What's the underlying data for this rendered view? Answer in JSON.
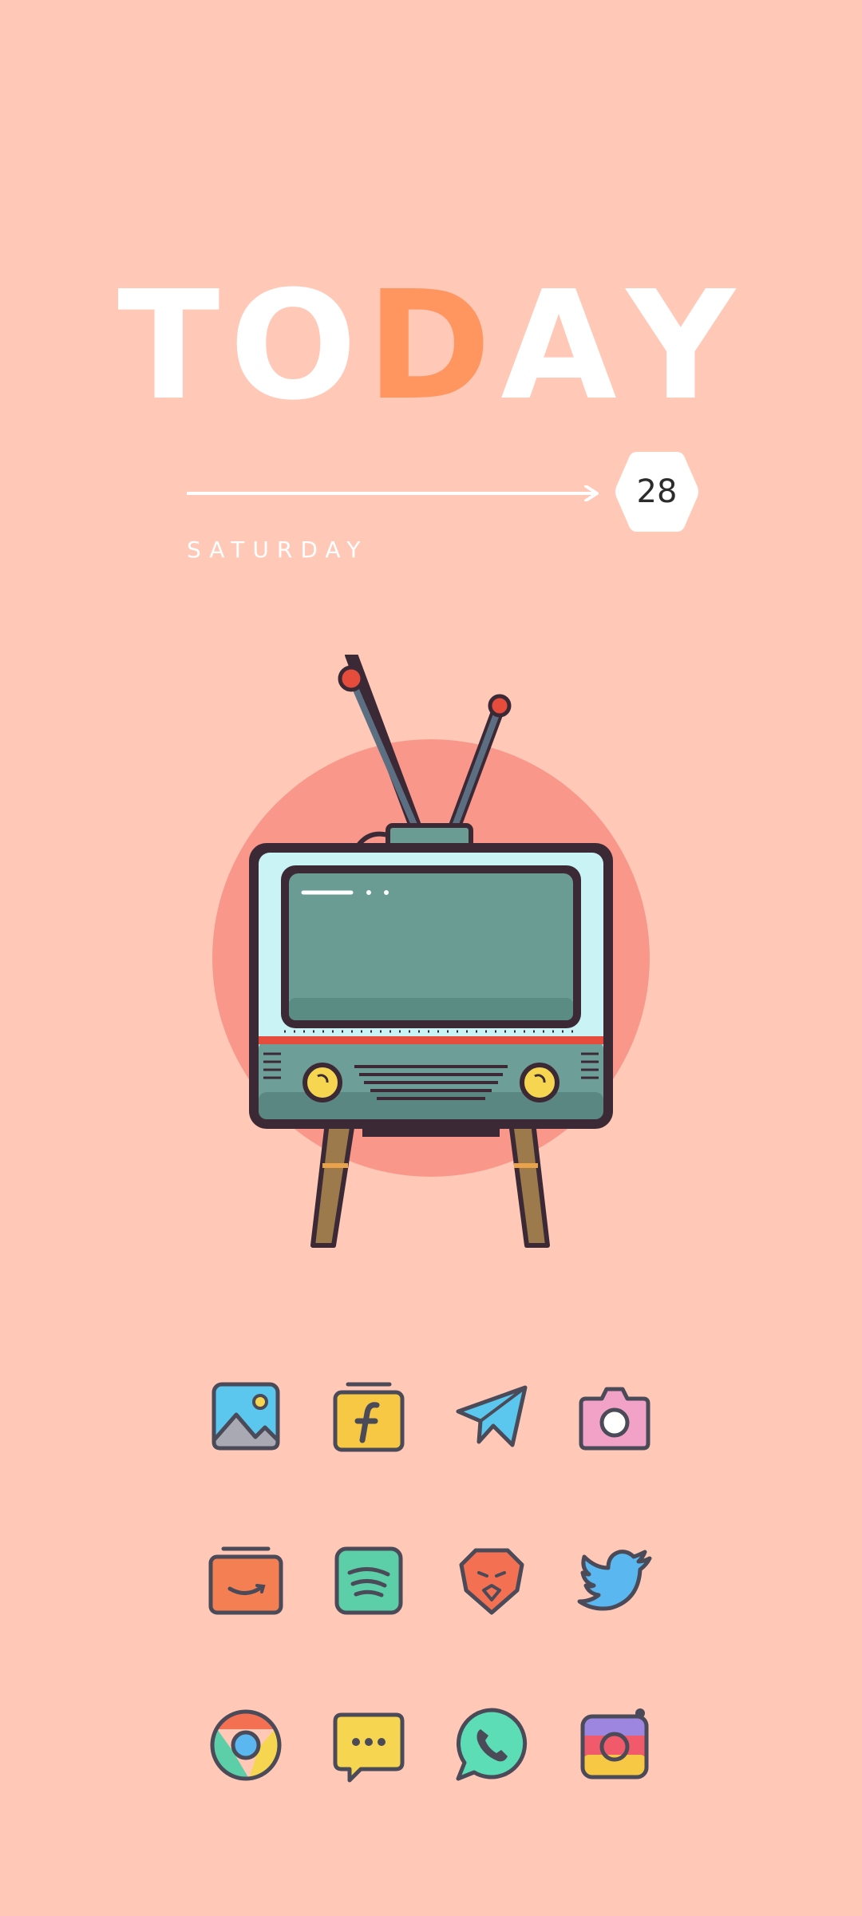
{
  "widget": {
    "title_letters": [
      "T",
      "O",
      "D",
      "A",
      "Y"
    ],
    "date_number": "28",
    "weekday": "SATURDAY"
  },
  "colors": {
    "background": "#FFC8B7",
    "accent": "#FF9660",
    "title": "#FFFFFF"
  },
  "illustration": {
    "name": "retro-tv-icon"
  },
  "apps": [
    {
      "name": "gallery-icon"
    },
    {
      "name": "flipkart-icon"
    },
    {
      "name": "telegram-icon"
    },
    {
      "name": "camera-icon"
    },
    {
      "name": "amazon-icon"
    },
    {
      "name": "spotify-icon"
    },
    {
      "name": "brave-icon"
    },
    {
      "name": "twitter-icon"
    },
    {
      "name": "chrome-icon"
    },
    {
      "name": "messages-icon"
    },
    {
      "name": "whatsapp-icon"
    },
    {
      "name": "instagram-icon"
    }
  ]
}
